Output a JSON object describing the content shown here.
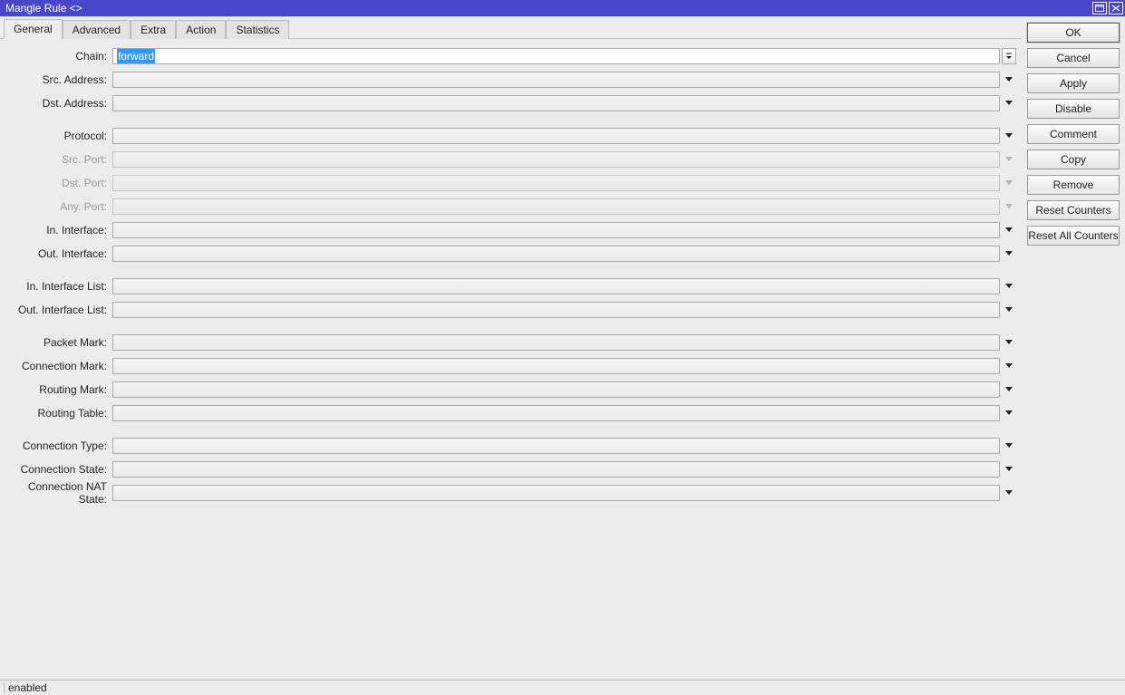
{
  "window": {
    "title": "Mangle Rule <>"
  },
  "tabs": {
    "general": "General",
    "advanced": "Advanced",
    "extra": "Extra",
    "action": "Action",
    "statistics": "Statistics"
  },
  "fields": {
    "chain": {
      "label": "Chain:",
      "value": "forward"
    },
    "src_address": {
      "label": "Src. Address:",
      "value": ""
    },
    "dst_address": {
      "label": "Dst. Address:",
      "value": ""
    },
    "protocol": {
      "label": "Protocol:",
      "value": ""
    },
    "src_port": {
      "label": "Src. Port:",
      "value": ""
    },
    "dst_port": {
      "label": "Dst. Port:",
      "value": ""
    },
    "any_port": {
      "label": "Any. Port:",
      "value": ""
    },
    "in_interface": {
      "label": "In. Interface:",
      "value": ""
    },
    "out_interface": {
      "label": "Out. Interface:",
      "value": ""
    },
    "in_interface_list": {
      "label": "In. Interface List:",
      "value": ""
    },
    "out_interface_list": {
      "label": "Out. Interface List:",
      "value": ""
    },
    "packet_mark": {
      "label": "Packet Mark:",
      "value": ""
    },
    "connection_mark": {
      "label": "Connection Mark:",
      "value": ""
    },
    "routing_mark": {
      "label": "Routing Mark:",
      "value": ""
    },
    "routing_table": {
      "label": "Routing Table:",
      "value": ""
    },
    "connection_type": {
      "label": "Connection Type:",
      "value": ""
    },
    "connection_state": {
      "label": "Connection State:",
      "value": ""
    },
    "connection_nat_state": {
      "label": "Connection NAT State:",
      "value": ""
    }
  },
  "buttons": {
    "ok": "OK",
    "cancel": "Cancel",
    "apply": "Apply",
    "disable": "Disable",
    "comment": "Comment",
    "copy": "Copy",
    "remove": "Remove",
    "reset_counters": "Reset Counters",
    "reset_all_counters": "Reset All Counters"
  },
  "status": {
    "text": "enabled"
  }
}
